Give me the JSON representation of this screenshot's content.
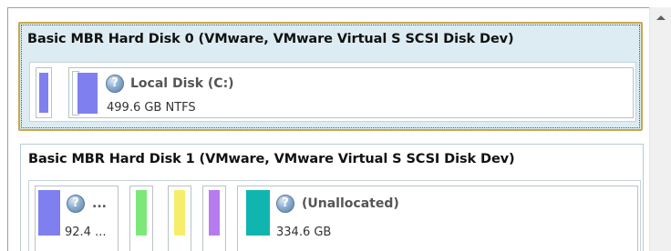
{
  "colors": {
    "selected_border": "#c8a84a",
    "selected_bg": "#dcecf2",
    "partition_blue": "#7f7ff0",
    "partition_green": "#7ce87a",
    "partition_yellow": "#f6ee6a",
    "partition_purple": "#b77bf0",
    "partition_teal": "#10b5b0"
  },
  "icons": {
    "partition_icon": "question-circle-icon",
    "scroll_up": "triangle-up-icon"
  },
  "disks": [
    {
      "title": "Basic MBR Hard Disk 0 (VMware, VMware Virtual S SCSI Disk Dev)",
      "selected": true,
      "partitions": [
        {
          "name": "",
          "info": "",
          "color": "#7f7ff0"
        },
        {
          "name": "Local Disk (C:)",
          "info": "499.6 GB NTFS",
          "color": "#7f7ff0"
        }
      ]
    },
    {
      "title": "Basic MBR Hard Disk 1 (VMware, VMware Virtual S SCSI Disk Dev)",
      "selected": false,
      "partitions": [
        {
          "name": "...",
          "info": "92.4 ...",
          "color": "#7f7ff0"
        },
        {
          "name": "",
          "info": "",
          "color": "#7ce87a"
        },
        {
          "name": "",
          "info": "",
          "color": "#f6ee6a"
        },
        {
          "name": "",
          "info": "",
          "color": "#b77bf0"
        },
        {
          "name": "(Unallocated)",
          "info": "334.6 GB",
          "color": "#10b5b0"
        }
      ]
    }
  ]
}
